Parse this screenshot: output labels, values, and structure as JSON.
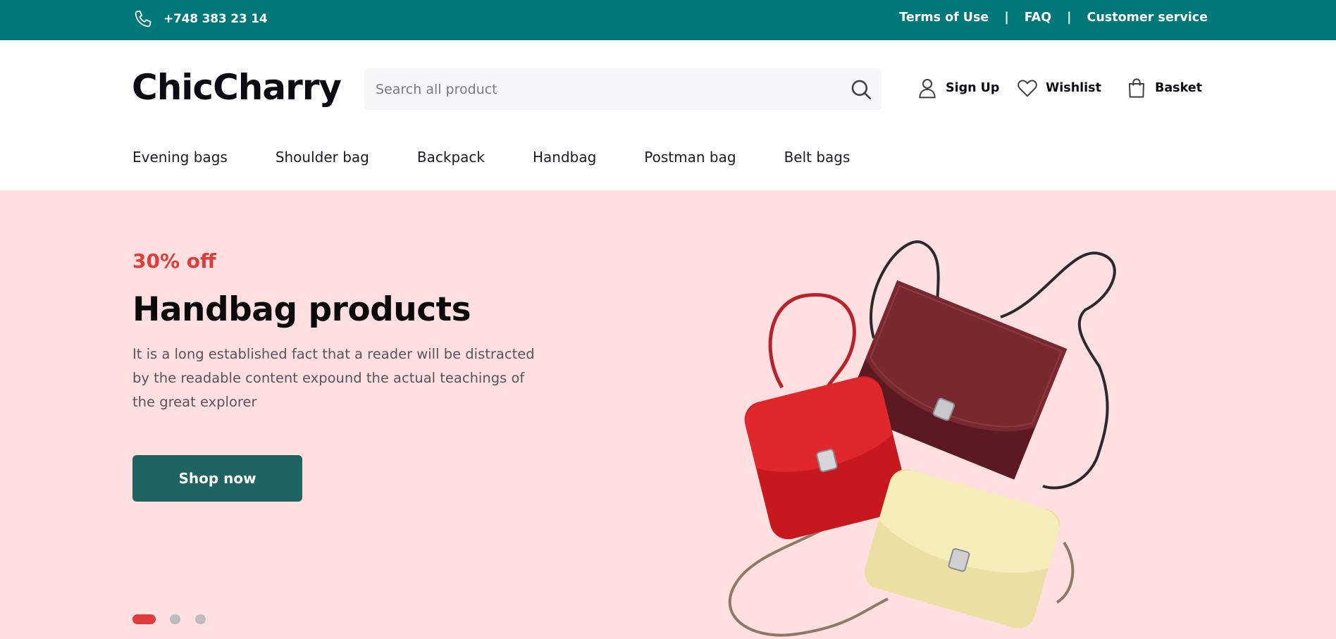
{
  "topbar": {
    "phone": "+748 383 23 14",
    "links": [
      "Terms of Use",
      "FAQ",
      "Customer service"
    ],
    "separator": "|",
    "bg_color": "#00787a"
  },
  "header": {
    "logo": "ChicCharry",
    "search": {
      "placeholder": "Search all product",
      "value": ""
    },
    "actions": {
      "signup": "Sign Up",
      "wishlist": "Wishlist",
      "basket": "Basket"
    },
    "categories": [
      "Evening bags",
      "Shoulder bag",
      "Backpack",
      "Handbag",
      "Postman bag",
      "Belt bags"
    ]
  },
  "hero": {
    "discount": "30% off",
    "title": "Handbag products",
    "description": "It is a long established fact that a reader will be distracted by the readable content expound the actual teachings of the great explorer",
    "cta": "Shop now",
    "slides": {
      "count": 3,
      "active": 1
    },
    "bg_color": "#ffdfdf",
    "accent_color": "#e03c3c",
    "button_color": "#206462"
  },
  "icons": [
    "phone-icon",
    "search-icon",
    "user-icon",
    "heart-icon",
    "shopping-bag-icon"
  ]
}
